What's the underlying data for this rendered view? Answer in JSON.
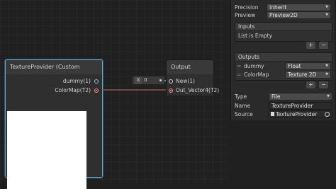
{
  "nodes": {
    "texture_provider": {
      "title": "TextureProvider (Custom Function)",
      "outputs": [
        "dummy(1)",
        "ColorMap(T2)"
      ]
    },
    "output": {
      "title": "Output",
      "inputs": [
        "New(1)",
        "Out_Vector4(T2)"
      ]
    },
    "constant": {
      "axis": "X",
      "value": "0"
    }
  },
  "inspector": {
    "precision_label": "Precision",
    "precision_value": "Inherit",
    "preview_label": "Preview",
    "preview_value": "Preview2D",
    "inputs_header": "Inputs",
    "inputs_empty": "List is Empty",
    "outputs_header": "Outputs",
    "outputs": [
      {
        "name": "dummy",
        "type": "Float"
      },
      {
        "name": "ColorMap",
        "type": "Texture 2D"
      }
    ],
    "add_symbol": "+",
    "remove_symbol": "−",
    "type_label": "Type",
    "type_value": "File",
    "name_label": "Name",
    "name_value": "TextureProvider",
    "source_label": "Source",
    "source_value": "TextureProvider"
  },
  "colors": {
    "port_float": "#8fc1e3",
    "port_texture": "#ff8b8b",
    "selection": "#6ea0c4"
  }
}
